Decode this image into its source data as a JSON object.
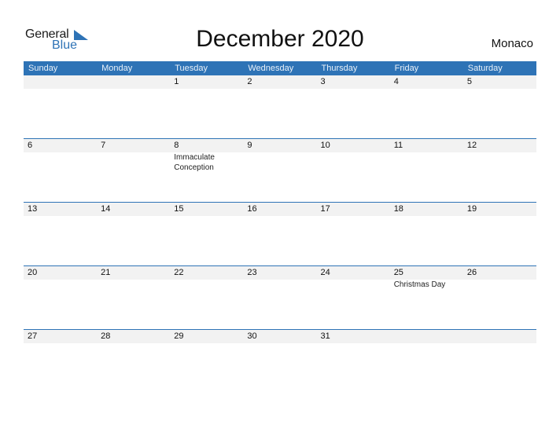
{
  "logo": {
    "line1": "General",
    "line2": "Blue",
    "icon": "triangle-flag-icon"
  },
  "title": "December 2020",
  "country": "Monaco",
  "colors": {
    "accent": "#2e73b6",
    "band": "#f2f2f2"
  },
  "weekdays": [
    "Sunday",
    "Monday",
    "Tuesday",
    "Wednesday",
    "Thursday",
    "Friday",
    "Saturday"
  ],
  "weeks": [
    [
      {
        "day": ""
      },
      {
        "day": ""
      },
      {
        "day": "1"
      },
      {
        "day": "2"
      },
      {
        "day": "3"
      },
      {
        "day": "4"
      },
      {
        "day": "5"
      }
    ],
    [
      {
        "day": "6"
      },
      {
        "day": "7"
      },
      {
        "day": "8",
        "event": "Immaculate Conception"
      },
      {
        "day": "9"
      },
      {
        "day": "10"
      },
      {
        "day": "11"
      },
      {
        "day": "12"
      }
    ],
    [
      {
        "day": "13"
      },
      {
        "day": "14"
      },
      {
        "day": "15"
      },
      {
        "day": "16"
      },
      {
        "day": "17"
      },
      {
        "day": "18"
      },
      {
        "day": "19"
      }
    ],
    [
      {
        "day": "20"
      },
      {
        "day": "21"
      },
      {
        "day": "22"
      },
      {
        "day": "23"
      },
      {
        "day": "24"
      },
      {
        "day": "25",
        "event": "Christmas Day"
      },
      {
        "day": "26"
      }
    ],
    [
      {
        "day": "27"
      },
      {
        "day": "28"
      },
      {
        "day": "29"
      },
      {
        "day": "30"
      },
      {
        "day": "31"
      },
      {
        "day": ""
      },
      {
        "day": ""
      }
    ]
  ]
}
